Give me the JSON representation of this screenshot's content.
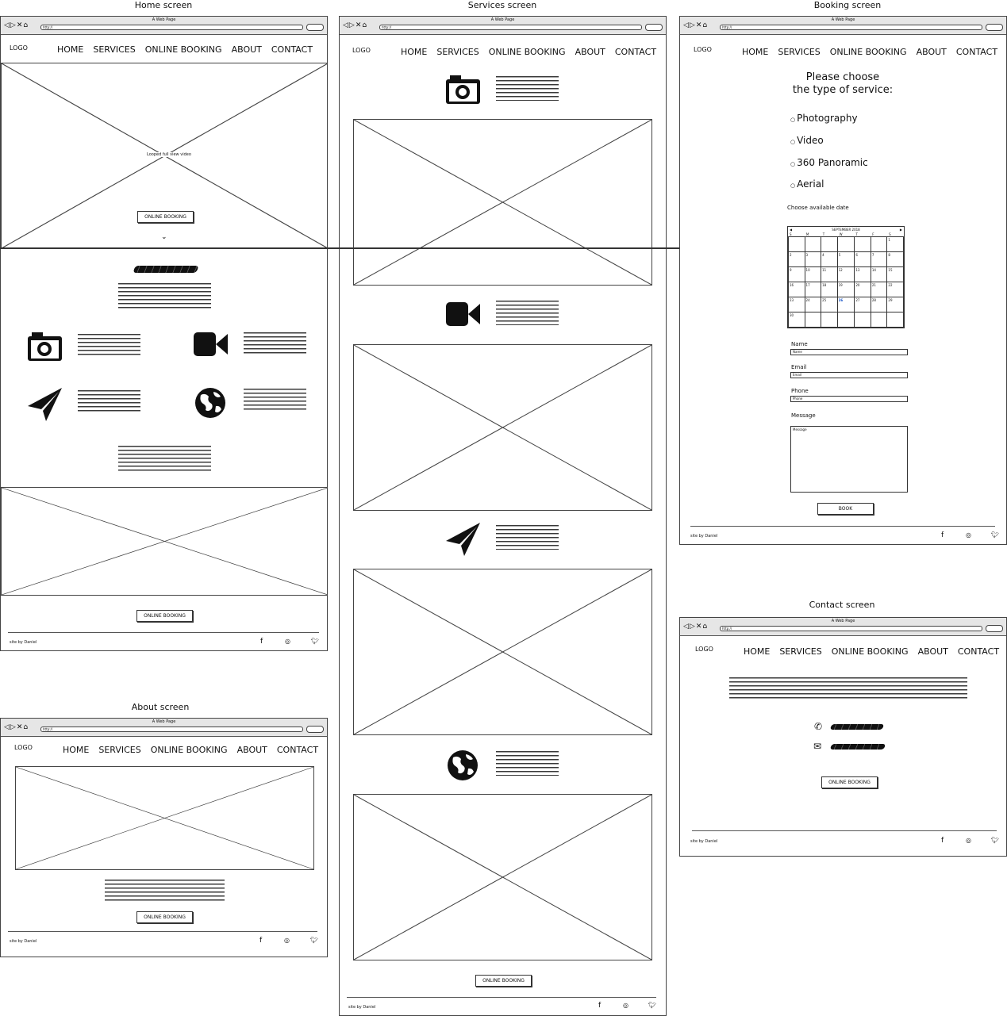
{
  "titles": {
    "home": "Home screen",
    "services": "Services screen",
    "booking": "Booking screen",
    "about": "About screen",
    "contact": "Contact screen"
  },
  "browser": {
    "page_title": "A Web Page",
    "url": "http://"
  },
  "logo": "LOGO",
  "nav": [
    "HOME",
    "SERVICES",
    "ONLINE BOOKING",
    "ABOUT",
    "CONTACT"
  ],
  "home": {
    "video_label": "Looped full view video",
    "booking_button": "ONLINE BOOKING",
    "bottom_button": "ONLINE BOOKING"
  },
  "footer": {
    "credit": "site by Daniel"
  },
  "services": {
    "booking_button": "ONLINE BOOKING"
  },
  "about": {
    "booking_button": "ONLINE BOOKING"
  },
  "contact": {
    "booking_button": "ONLINE BOOKING"
  },
  "booking": {
    "heading_line1": "Please choose",
    "heading_line2": "the type of service:",
    "services": [
      "Photography",
      "Video",
      "360 Panoramic",
      "Aerial"
    ],
    "date_label": "Choose available date",
    "calendar": {
      "month": "SEPTEMBER 2018",
      "weekdays": [
        "S",
        "M",
        "T",
        "W",
        "T",
        "F",
        "S"
      ],
      "weeks": [
        [
          "",
          "",
          "",
          "",
          "",
          "",
          "1"
        ],
        [
          "2",
          "3",
          "4",
          "5",
          "6",
          "7",
          "8"
        ],
        [
          "9",
          "10",
          "11",
          "12",
          "13",
          "14",
          "15"
        ],
        [
          "16",
          "17",
          "18",
          "19",
          "20",
          "21",
          "22"
        ],
        [
          "23",
          "24",
          "25",
          "26",
          "27",
          "28",
          "29"
        ],
        [
          "30",
          "",
          "",
          "",
          "",
          "",
          ""
        ]
      ],
      "selected": "26"
    },
    "fields": {
      "name_label": "Name",
      "name_placeholder": "Name",
      "email_label": "Email",
      "email_placeholder": "Email",
      "phone_label": "Phone",
      "phone_placeholder": "Phone",
      "message_label": "Message",
      "message_placeholder": "Message"
    },
    "book_button": "BOOK"
  }
}
